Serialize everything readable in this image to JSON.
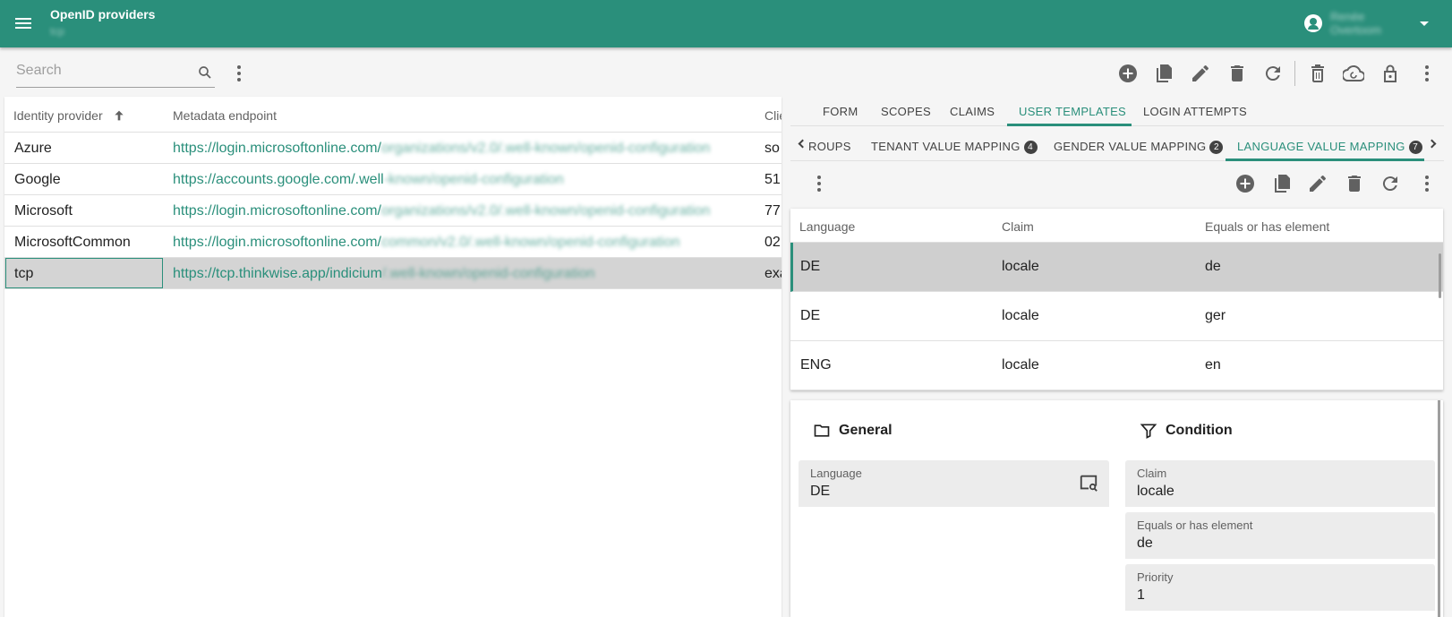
{
  "header": {
    "title": "OpenID providers",
    "subtitle": "tcp",
    "user_name": "Renée Overtoom"
  },
  "left": {
    "search": {
      "placeholder": "Search",
      "value": ""
    },
    "grid": {
      "columns": [
        "Identity provider",
        "Metadata endpoint",
        "Clie"
      ],
      "rows": [
        {
          "provider": "Azure",
          "endpoint_visible": "https://login.microsoftonline.com/",
          "endpoint_blurred": "organizations/v2.0/.well-known/openid-configuration",
          "client": "so"
        },
        {
          "provider": "Google",
          "endpoint_visible": "https://accounts.google.com/.well",
          "endpoint_blurred": "-known/openid-configuration",
          "client": "51"
        },
        {
          "provider": "Microsoft",
          "endpoint_visible": "https://login.microsoftonline.com/",
          "endpoint_blurred": "organizations/v2.0/.well-known/openid-configuration",
          "client": "77"
        },
        {
          "provider": "MicrosoftCommon",
          "endpoint_visible": "https://login.microsoftonline.com/",
          "endpoint_blurred": "common/v2.0/.well-known/openid-configuration",
          "client": "02"
        },
        {
          "provider": "tcp",
          "endpoint_visible": "https://tcp.thinkwise.app/indicium",
          "endpoint_blurred": "/.well-known/openid-configuration",
          "client": "exa"
        }
      ],
      "selected_index": 4
    }
  },
  "right": {
    "tabs": [
      {
        "label": "FORM"
      },
      {
        "label": "SCOPES"
      },
      {
        "label": "CLAIMS"
      },
      {
        "label": "USER TEMPLATES",
        "active": true
      },
      {
        "label": "LOGIN ATTEMPTS"
      }
    ],
    "subtabs": [
      {
        "label": "ROUPS"
      },
      {
        "label": "TENANT VALUE MAPPING",
        "badge": "4"
      },
      {
        "label": "GENDER VALUE MAPPING",
        "badge": "2"
      },
      {
        "label": "LANGUAGE VALUE MAPPING",
        "badge": "7",
        "active": true
      }
    ],
    "grid": {
      "columns": [
        "Language",
        "Claim",
        "Equals or has element"
      ],
      "rows": [
        {
          "language": "DE",
          "claim": "locale",
          "value": "de"
        },
        {
          "language": "DE",
          "claim": "locale",
          "value": "ger"
        },
        {
          "language": "ENG",
          "claim": "locale",
          "value": "en"
        }
      ],
      "selected_index": 0
    },
    "form": {
      "general_title": "General",
      "condition_title": "Condition",
      "language_label": "Language",
      "language_value": "DE",
      "claim_label": "Claim",
      "claim_value": "locale",
      "equals_label": "Equals or has element",
      "equals_value": "de",
      "priority_label": "Priority",
      "priority_value": "1"
    }
  },
  "colors": {
    "primary": "#2a8f7b",
    "selected_row": "#d4d4d4",
    "icon": "#616161"
  },
  "icons": [
    "menu-icon",
    "account-circle-icon",
    "search-icon",
    "more-vert-icon",
    "add-circle-icon",
    "copy-icon",
    "edit-icon",
    "delete-icon",
    "refresh-icon",
    "delete-all-icon",
    "cloud-sync-icon",
    "lock-open-icon",
    "folder-icon",
    "filter-icon",
    "lookup-icon"
  ]
}
